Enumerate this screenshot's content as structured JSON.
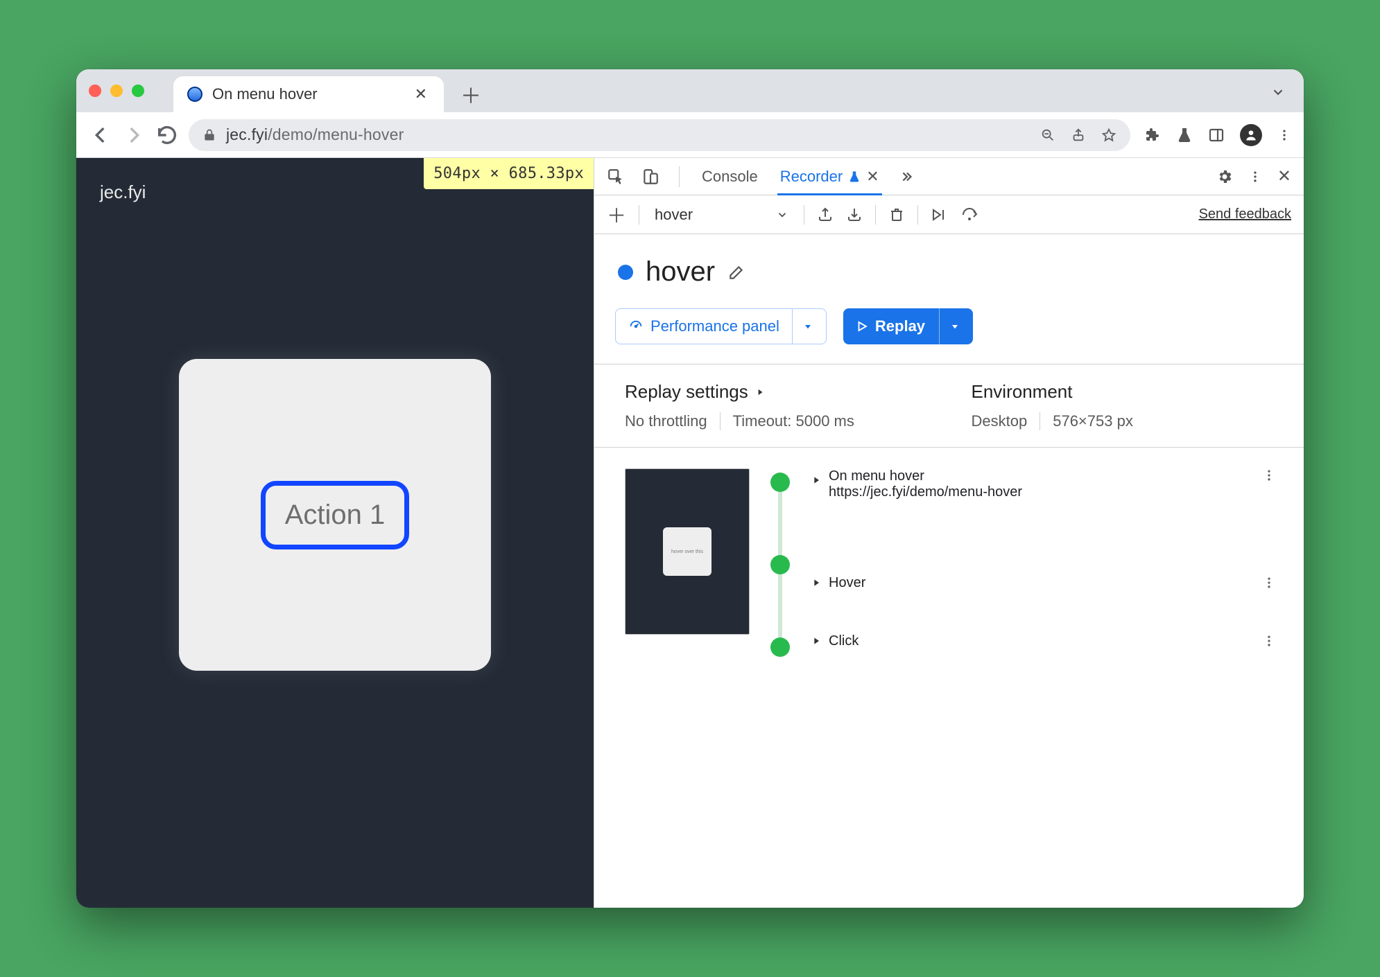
{
  "browser": {
    "tab_title": "On menu hover",
    "url_host": "jec.fyi",
    "url_path": "/demo/menu-hover"
  },
  "page": {
    "title": "jec.fyi",
    "size_label": "504px × 685.33px",
    "action_label": "Action 1"
  },
  "devtools": {
    "tabs": {
      "console": "Console",
      "recorder": "Recorder"
    },
    "recording_select": "hover",
    "feedback": "Send feedback",
    "recording_name": "hover",
    "perf_button": "Performance panel",
    "replay_button": "Replay",
    "settings": {
      "replay_title": "Replay settings",
      "throttling": "No throttling",
      "timeout": "Timeout: 5000 ms",
      "env_title": "Environment",
      "env_device": "Desktop",
      "env_size": "576×753 px"
    },
    "steps": [
      {
        "title": "On menu hover",
        "sub": "https://jec.fyi/demo/menu-hover",
        "bold": true
      },
      {
        "title": "Hover",
        "bold": false
      },
      {
        "title": "Click",
        "bold": false
      }
    ]
  }
}
